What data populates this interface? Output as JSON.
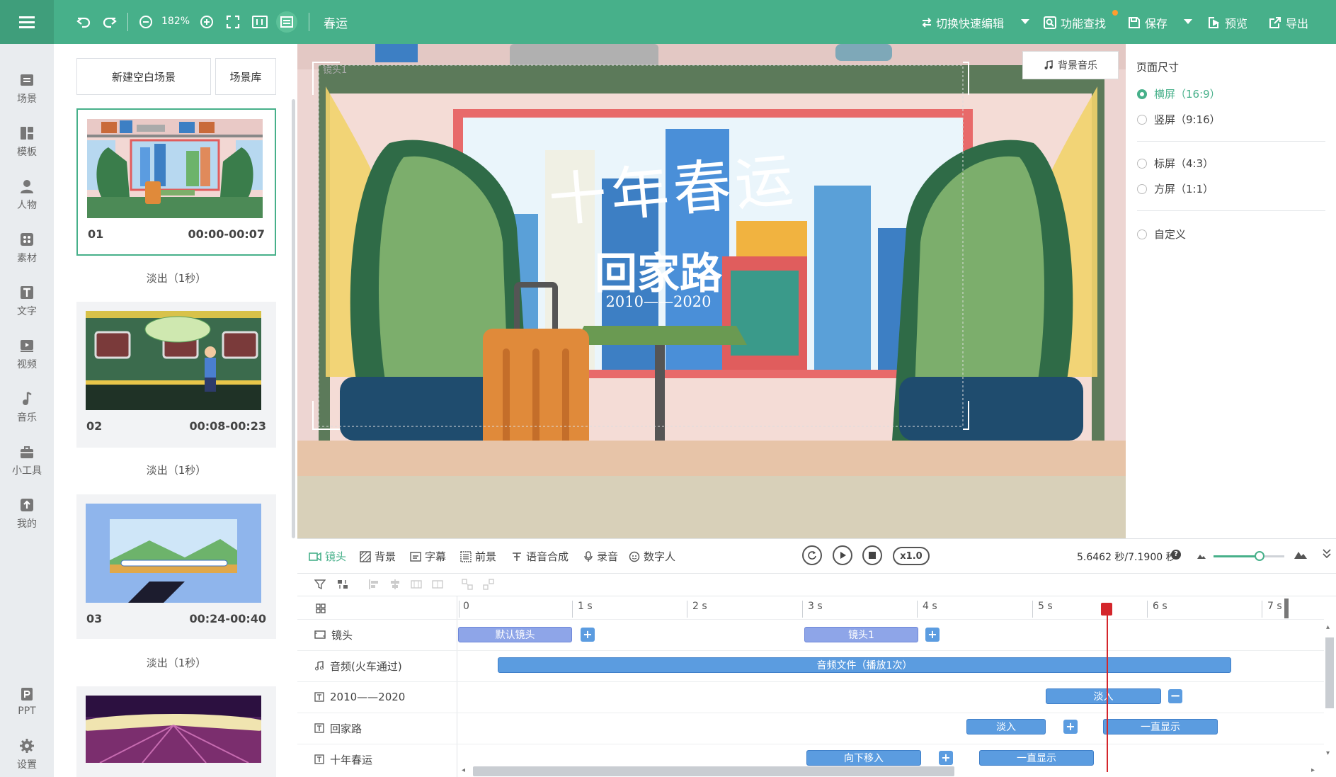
{
  "toolbar": {
    "zoom_level": "182%",
    "doc_title": "春运",
    "quick_edit": "切换快速编辑",
    "function_search": "功能查找",
    "save": "保存",
    "preview": "预览",
    "export": "导出",
    "accent_color": "#47b08a"
  },
  "rail": {
    "items": [
      {
        "label": "场景",
        "icon": "scene-icon"
      },
      {
        "label": "模板",
        "icon": "template-icon"
      },
      {
        "label": "人物",
        "icon": "person-icon"
      },
      {
        "label": "素材",
        "icon": "material-icon"
      },
      {
        "label": "文字",
        "icon": "text-icon"
      },
      {
        "label": "视频",
        "icon": "video-icon"
      },
      {
        "label": "音乐",
        "icon": "music-icon"
      },
      {
        "label": "小工具",
        "icon": "toolbox-icon"
      },
      {
        "label": "我的",
        "icon": "upload-icon"
      },
      {
        "label": "PPT",
        "icon": "ppt-icon"
      },
      {
        "label": "设置",
        "icon": "gear-icon"
      }
    ]
  },
  "scene_panel": {
    "new_blank": "新建空白场景",
    "library": "场景库",
    "scenes": [
      {
        "num": "01",
        "time": "00:00-00:07",
        "transition": "淡出（1秒）"
      },
      {
        "num": "02",
        "time": "00:08-00:23",
        "transition": "淡出（1秒）"
      },
      {
        "num": "03",
        "time": "00:24-00:40",
        "transition": "淡出（1秒）"
      },
      {
        "num": "",
        "time": "",
        "transition": ""
      }
    ]
  },
  "canvas": {
    "camera_label": "镜头1",
    "bgm_button": "背景音乐",
    "title_text": "十年春运",
    "subtitle_text": "回家路",
    "years_text": "2010——2020"
  },
  "page_size": {
    "title": "页面尺寸",
    "options": [
      {
        "label": "横屏（16:9）",
        "checked": true
      },
      {
        "label": "竖屏（9:16）",
        "checked": false
      },
      {
        "label": "标屏（4:3）",
        "checked": false
      },
      {
        "label": "方屏（1:1）",
        "checked": false
      },
      {
        "label": "自定义",
        "checked": false
      }
    ]
  },
  "timeline": {
    "tools": [
      "镜头",
      "背景",
      "字幕",
      "前景",
      "语音合成",
      "录音",
      "数字人"
    ],
    "speed": "x1.0",
    "time_readout": "5.6462 秒/7.1900 秒",
    "ruler": [
      "0",
      "1 s",
      "2 s",
      "3 s",
      "4 s",
      "5 s",
      "6 s",
      "7 s"
    ],
    "tracks": [
      {
        "label": "镜头",
        "icon": "camera-icon"
      },
      {
        "label": "音频(火车通过)",
        "icon": "music-note-icon"
      },
      {
        "label": "2010——2020",
        "icon": "text-icon"
      },
      {
        "label": "回家路",
        "icon": "text-icon"
      },
      {
        "label": "十年春运",
        "icon": "text-icon"
      }
    ],
    "clips": {
      "default_camera": "默认镜头",
      "camera1": "镜头1",
      "audio_file": "音频文件（播放1次）",
      "fade_in_1": "淡入",
      "fade_in_2": "淡入",
      "always_show_1": "一直显示",
      "move_down": "向下移入",
      "always_show_2": "一直显示"
    },
    "playhead_seconds": 5.6462,
    "total_seconds": 7.19
  }
}
